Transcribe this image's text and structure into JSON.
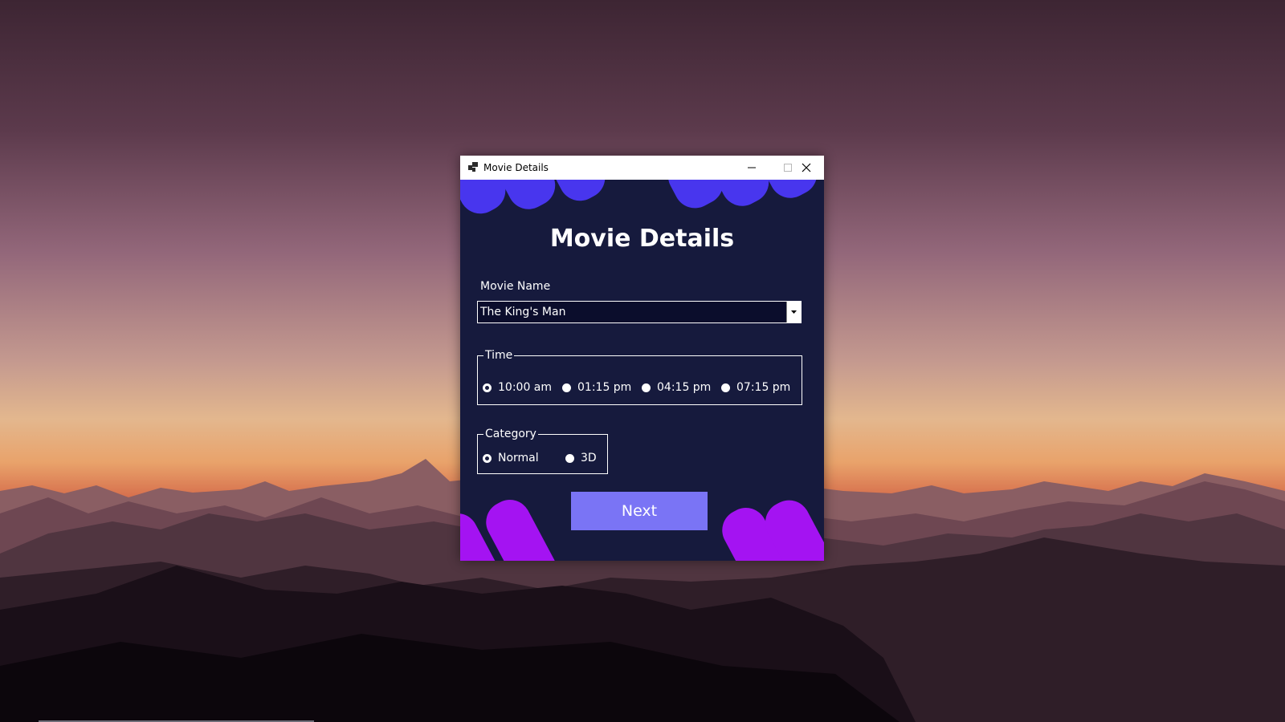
{
  "window": {
    "title": "Movie Details",
    "controls": {
      "minimize_icon": "minimize-icon",
      "maximize_icon": "maximize-icon",
      "close_icon": "close-icon"
    }
  },
  "form": {
    "heading": "Movie Details",
    "movie_name": {
      "label": "Movie Name",
      "value": "The King's Man"
    },
    "time": {
      "legend": "Time",
      "options": [
        {
          "label": "10:00 am",
          "checked": true
        },
        {
          "label": "01:15 pm",
          "checked": false
        },
        {
          "label": "04:15 pm",
          "checked": false
        },
        {
          "label": "07:15 pm",
          "checked": false
        }
      ]
    },
    "category": {
      "legend": "Category",
      "options": [
        {
          "label": "Normal",
          "checked": true
        },
        {
          "label": "3D",
          "checked": false
        }
      ]
    },
    "next_label": "Next"
  },
  "colors": {
    "window_bg": "#161a3d",
    "top_shapes": "#4836ee",
    "bottom_shapes": "#a413f2",
    "next_button": "#7a74f5",
    "combo_bg": "#0b0d2c"
  }
}
